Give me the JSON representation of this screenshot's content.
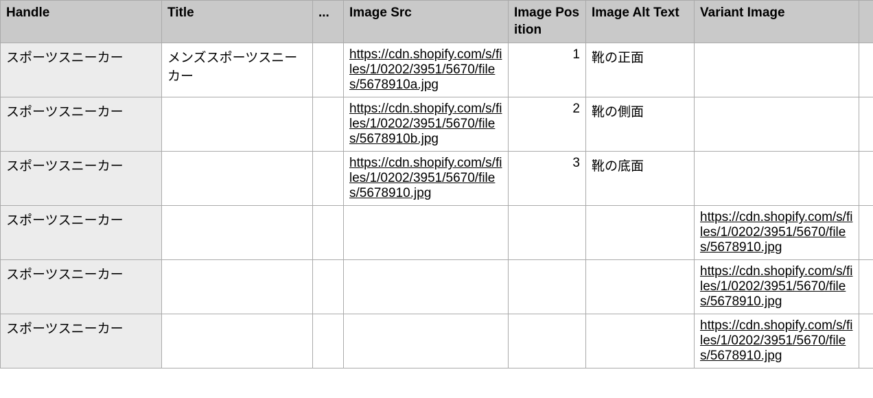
{
  "headers": {
    "handle": "Handle",
    "title": "Title",
    "dots": "...",
    "src": "Image Src",
    "pos": "Image Position",
    "alt": "Image Alt Text",
    "var": "Variant Image",
    "end": ""
  },
  "rows": [
    {
      "handle": "スポーツスニーカー",
      "title": "メンズスポーツスニーカー",
      "dots": "",
      "src": "https://cdn.shopify.com/s/files/1/0202/3951/5670/files/5678910a.jpg",
      "pos": "1",
      "alt": "靴の正面",
      "var": ""
    },
    {
      "handle": "スポーツスニーカー",
      "title": "",
      "dots": "",
      "src": "https://cdn.shopify.com/s/files/1/0202/3951/5670/files/5678910b.jpg",
      "pos": "2",
      "alt": "靴の側面",
      "var": ""
    },
    {
      "handle": "スポーツスニーカー",
      "title": "",
      "dots": "",
      "src": "https://cdn.shopify.com/s/files/1/0202/3951/5670/files/5678910.jpg",
      "pos": "3",
      "alt": "靴の底面",
      "var": ""
    },
    {
      "handle": "スポーツスニーカー",
      "title": "",
      "dots": "",
      "src": "",
      "pos": "",
      "alt": "",
      "var": "https://cdn.shopify.com/s/files/1/0202/3951/5670/files/5678910.jpg"
    },
    {
      "handle": "スポーツスニーカー",
      "title": "",
      "dots": "",
      "src": "",
      "pos": "",
      "alt": "",
      "var": "https://cdn.shopify.com/s/files/1/0202/3951/5670/files/5678910.jpg"
    },
    {
      "handle": "スポーツスニーカー",
      "title": "",
      "dots": "",
      "src": "",
      "pos": "",
      "alt": "",
      "var": "https://cdn.shopify.com/s/files/1/0202/3951/5670/files/5678910.jpg"
    }
  ]
}
